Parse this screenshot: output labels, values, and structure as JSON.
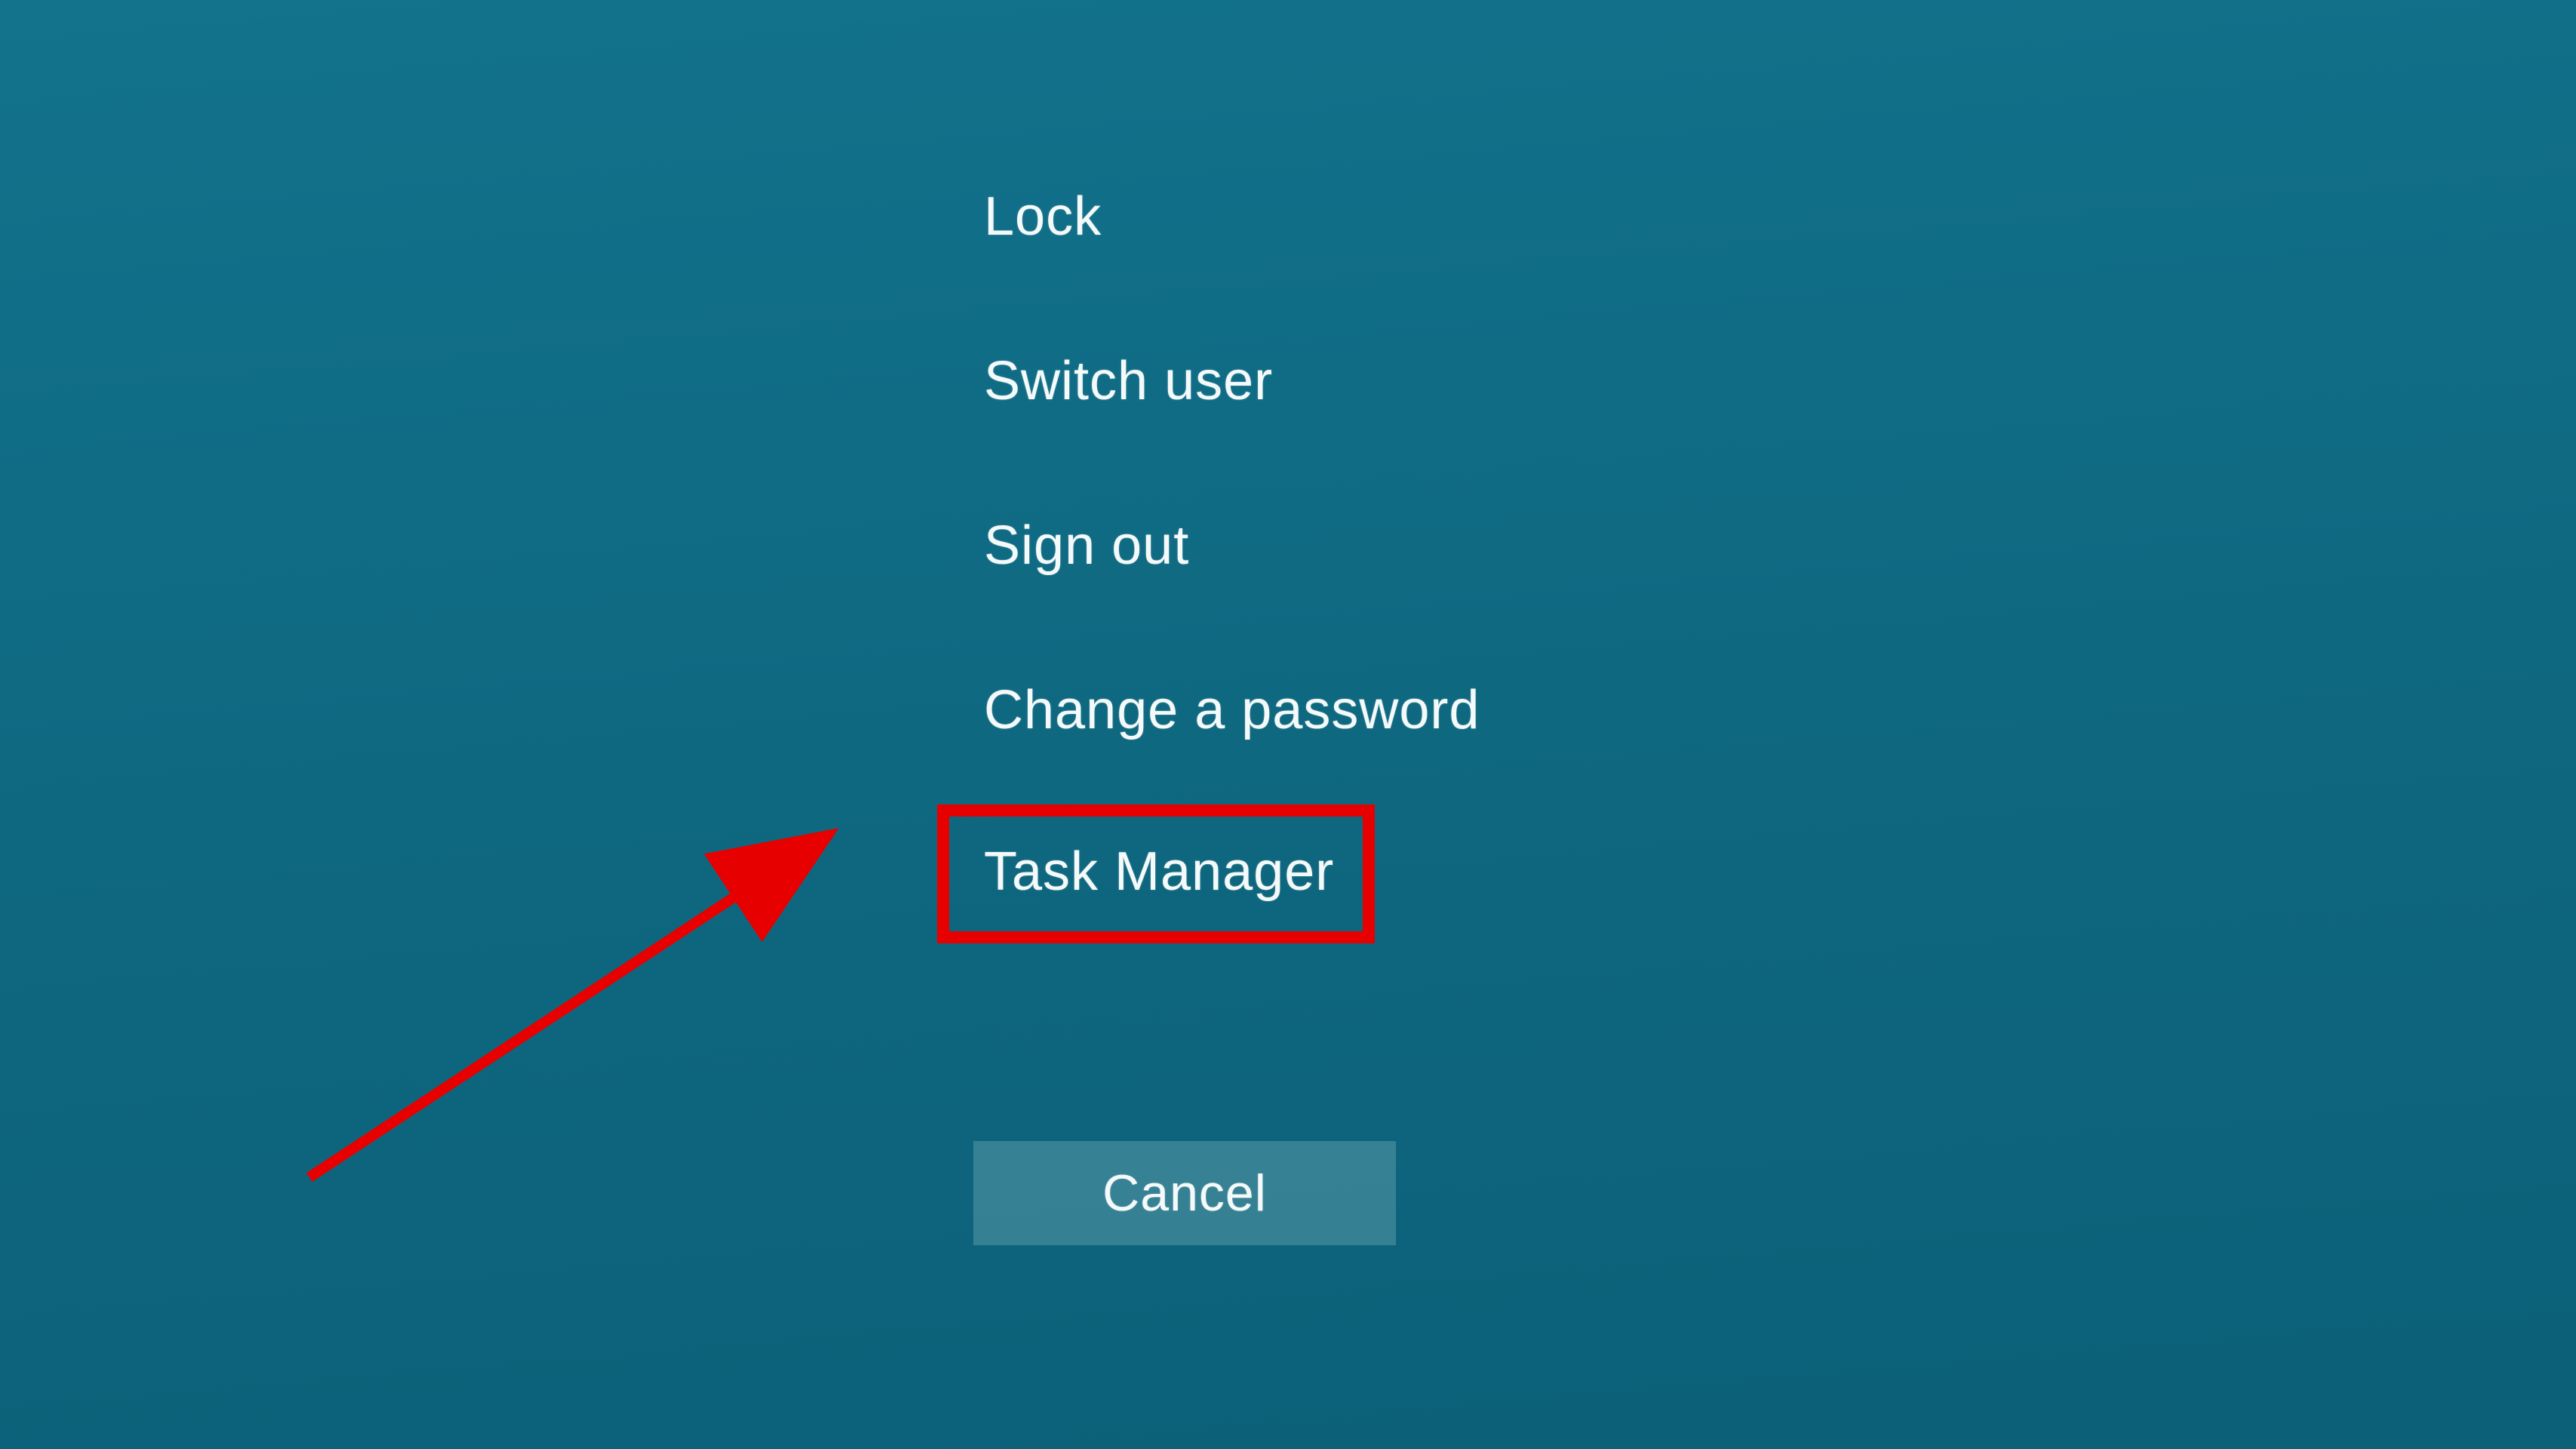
{
  "menu": {
    "items": [
      {
        "label": "Lock"
      },
      {
        "label": "Switch user"
      },
      {
        "label": "Sign out"
      },
      {
        "label": "Change a password"
      },
      {
        "label": "Task Manager"
      }
    ]
  },
  "cancel_label": "Cancel",
  "annotation": {
    "highlighted_index": 4,
    "arrow_color": "#e60000"
  }
}
